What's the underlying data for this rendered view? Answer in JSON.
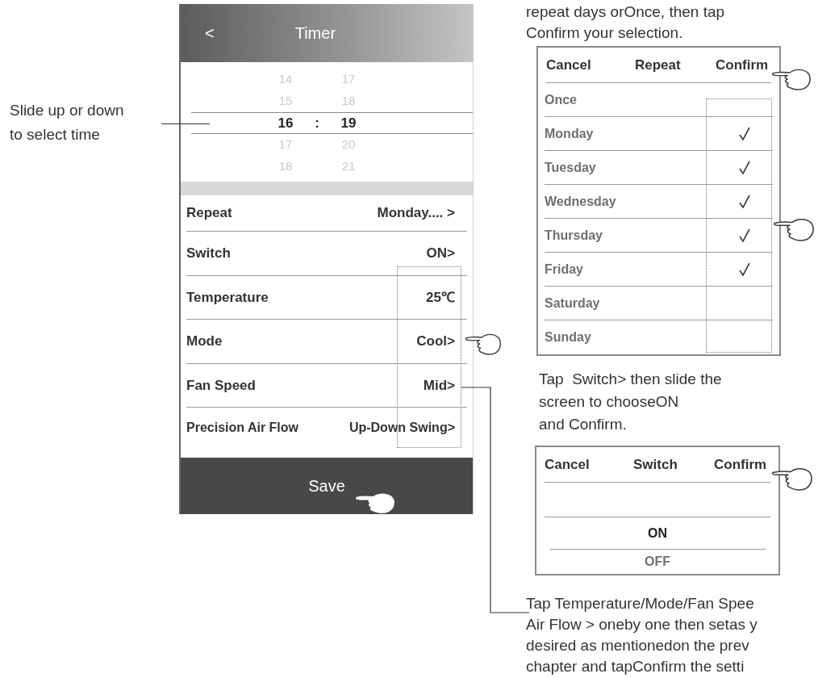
{
  "annotation": {
    "lines": [
      "Slide up or down",
      "to select time"
    ]
  },
  "phone": {
    "header": {
      "back": "<",
      "title": "Timer"
    },
    "picker": {
      "separator": ":",
      "rows": [
        {
          "hour": "14",
          "minute": "17",
          "selected": false
        },
        {
          "hour": "15",
          "minute": "18",
          "selected": false
        },
        {
          "hour": "16",
          "minute": "19",
          "selected": true
        },
        {
          "hour": "17",
          "minute": "20",
          "selected": false
        },
        {
          "hour": "18",
          "minute": "21",
          "selected": false
        }
      ]
    },
    "settings": [
      {
        "label": "Repeat",
        "value": "Monday.... >"
      },
      {
        "label": "Switch",
        "value": "ON>"
      },
      {
        "label": "Temperature",
        "value": "25℃"
      },
      {
        "label": "Mode",
        "value": "Cool>"
      },
      {
        "label": "Fan Speed",
        "value": "Mid>"
      },
      {
        "label": "Precision Air Flow",
        "value": "Up-Down Swing>"
      }
    ],
    "save_button": "Save"
  },
  "repeat_note": {
    "lines": [
      "repeat days orOnce, then tap",
      "Confirm your selection."
    ]
  },
  "repeat_dialog": {
    "cancel": "Cancel",
    "title": "Repeat",
    "confirm": "Confirm",
    "options": [
      {
        "label": "Once",
        "checked": false
      },
      {
        "label": "Monday",
        "checked": true
      },
      {
        "label": "Tuesday",
        "checked": true
      },
      {
        "label": "Wednesday",
        "checked": true
      },
      {
        "label": "Thursday",
        "checked": true
      },
      {
        "label": "Friday",
        "checked": true
      },
      {
        "label": "Saturday",
        "checked": false
      },
      {
        "label": "Sunday",
        "checked": false
      }
    ]
  },
  "switch_note": {
    "lines": [
      "Tap  Switch> then slide the",
      "screen to chooseON",
      "and Confirm."
    ]
  },
  "switch_dialog": {
    "cancel": "Cancel",
    "title": "Switch",
    "confirm": "Confirm",
    "options": [
      {
        "label": "ON",
        "selected": true
      },
      {
        "label": "OFF",
        "selected": false
      }
    ]
  },
  "settings_note": {
    "lines": [
      "Tap Temperature/Mode/Fan Spee",
      "Air Flow > oneby one then setas y",
      "desired as mentionedon the prev",
      "chapter and tapConfirm the setti"
    ]
  }
}
